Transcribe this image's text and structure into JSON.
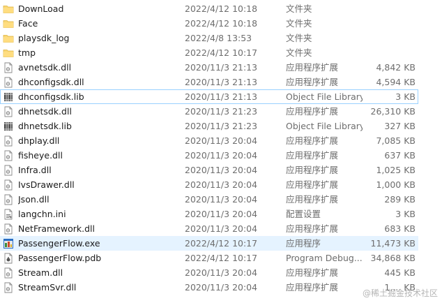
{
  "colors": {
    "selected_border": "#99d1ff",
    "hover_background": "#e5f3ff",
    "folder_yellow": "#ffd766",
    "secondary_text": "#6d6d6d"
  },
  "files": [
    {
      "name": "DownLoad",
      "date": "2022/4/12 10:18",
      "type": "文件夹",
      "size": "",
      "icon": "folder-icon"
    },
    {
      "name": "Face",
      "date": "2022/4/12 10:18",
      "type": "文件夹",
      "size": "",
      "icon": "folder-icon"
    },
    {
      "name": "playsdk_log",
      "date": "2022/4/8 13:53",
      "type": "文件夹",
      "size": "",
      "icon": "folder-icon"
    },
    {
      "name": "tmp",
      "date": "2022/4/12 10:17",
      "type": "文件夹",
      "size": "",
      "icon": "folder-icon"
    },
    {
      "name": "avnetsdk.dll",
      "date": "2020/11/3 21:13",
      "type": "应用程序扩展",
      "size": "4,842 KB",
      "icon": "dll-file-icon"
    },
    {
      "name": "dhconfigsdk.dll",
      "date": "2020/11/3 21:13",
      "type": "应用程序扩展",
      "size": "4,594 KB",
      "icon": "dll-file-icon"
    },
    {
      "name": "dhconfigsdk.lib",
      "date": "2020/11/3 21:13",
      "type": "Object File Library",
      "size": "3 KB",
      "icon": "lib-file-icon",
      "selected": true
    },
    {
      "name": "dhnetsdk.dll",
      "date": "2020/11/3 21:23",
      "type": "应用程序扩展",
      "size": "26,310 KB",
      "icon": "dll-file-icon"
    },
    {
      "name": "dhnetsdk.lib",
      "date": "2020/11/3 21:23",
      "type": "Object File Library",
      "size": "327 KB",
      "icon": "lib-file-icon"
    },
    {
      "name": "dhplay.dll",
      "date": "2020/11/3 20:04",
      "type": "应用程序扩展",
      "size": "7,085 KB",
      "icon": "dll-file-icon"
    },
    {
      "name": "fisheye.dll",
      "date": "2020/11/3 20:04",
      "type": "应用程序扩展",
      "size": "637 KB",
      "icon": "dll-file-icon"
    },
    {
      "name": "Infra.dll",
      "date": "2020/11/3 20:04",
      "type": "应用程序扩展",
      "size": "1,025 KB",
      "icon": "dll-file-icon"
    },
    {
      "name": "IvsDrawer.dll",
      "date": "2020/11/3 20:04",
      "type": "应用程序扩展",
      "size": "1,000 KB",
      "icon": "dll-file-icon"
    },
    {
      "name": "Json.dll",
      "date": "2020/11/3 20:04",
      "type": "应用程序扩展",
      "size": "289 KB",
      "icon": "dll-file-icon"
    },
    {
      "name": "langchn.ini",
      "date": "2020/11/3 20:04",
      "type": "配置设置",
      "size": "3 KB",
      "icon": "ini-file-icon"
    },
    {
      "name": "NetFramework.dll",
      "date": "2020/11/3 20:04",
      "type": "应用程序扩展",
      "size": "683 KB",
      "icon": "dll-file-icon"
    },
    {
      "name": "PassengerFlow.exe",
      "date": "2022/4/12 10:17",
      "type": "应用程序",
      "size": "11,473 KB",
      "icon": "exe-file-icon",
      "hovered": true
    },
    {
      "name": "PassengerFlow.pdb",
      "date": "2022/4/12 10:17",
      "type": "Program Debug...",
      "size": "34,868 KB",
      "icon": "pdb-file-icon"
    },
    {
      "name": "Stream.dll",
      "date": "2020/11/3 20:04",
      "type": "应用程序扩展",
      "size": "445 KB",
      "icon": "dll-file-icon"
    },
    {
      "name": "StreamSvr.dll",
      "date": "2020/11/3 20:04",
      "type": "应用程序扩展",
      "size": "1,... KB",
      "icon": "dll-file-icon"
    }
  ],
  "watermark": "@稀土掘金技术社区"
}
